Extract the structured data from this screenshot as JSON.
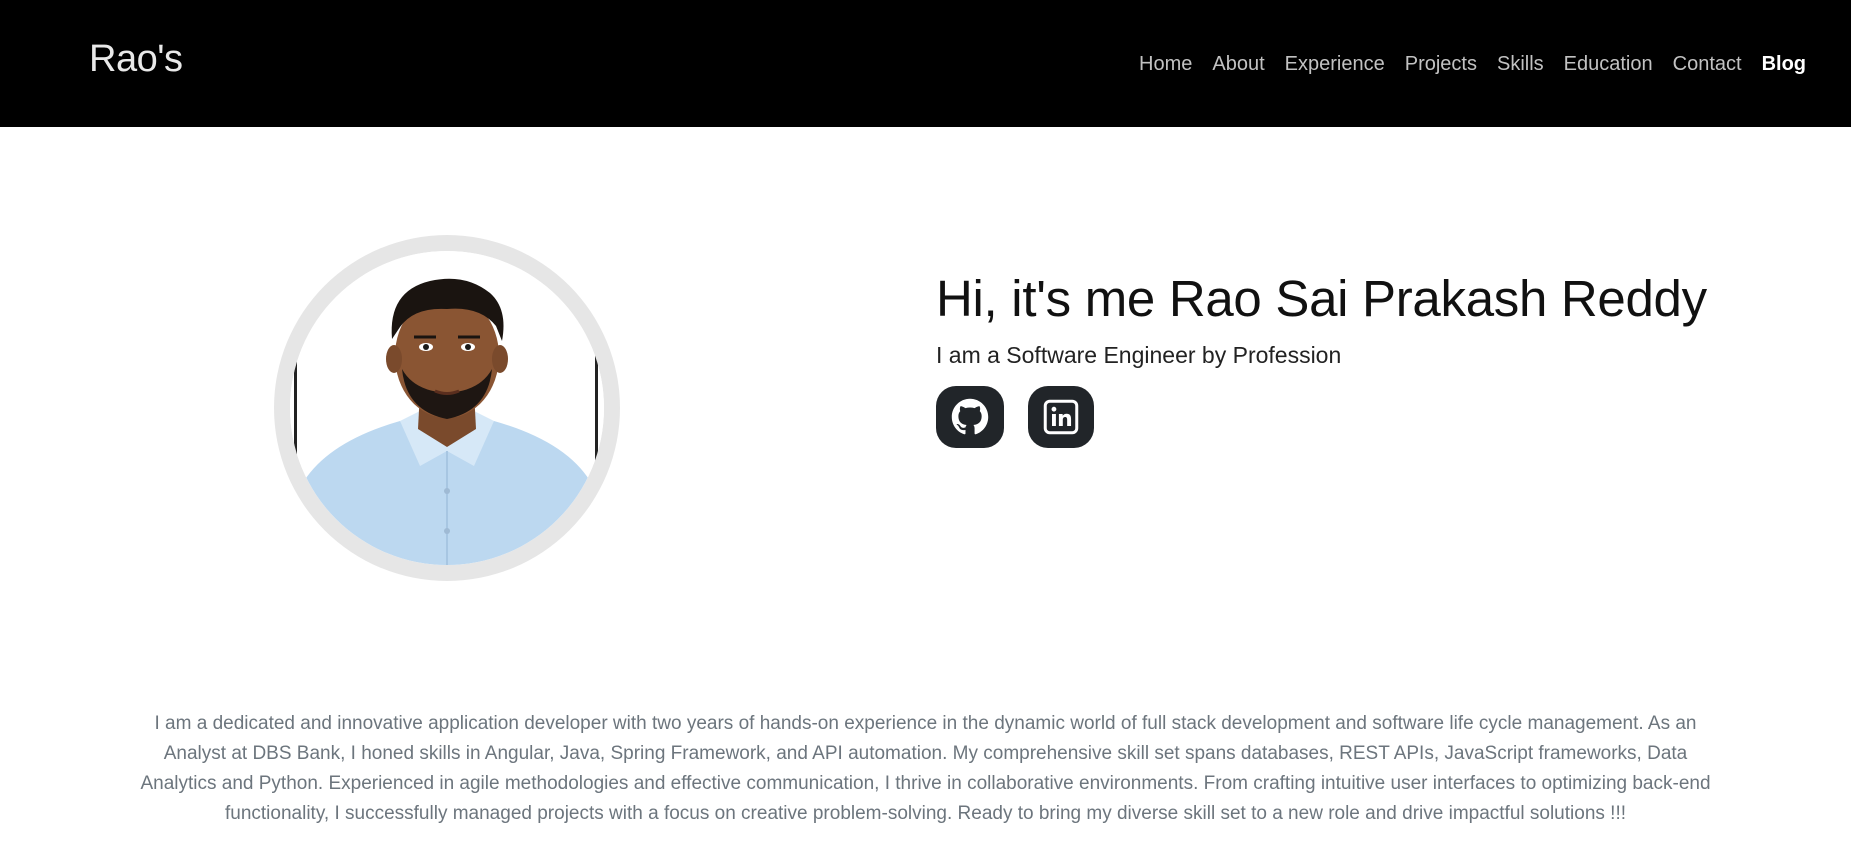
{
  "navbar": {
    "brand": "Rao's",
    "links": [
      "Home",
      "About",
      "Experience",
      "Projects",
      "Skills",
      "Education",
      "Contact",
      "Blog"
    ],
    "active_link": "Blog"
  },
  "hero": {
    "title": "Hi, it's me Rao Sai Prakash Reddy",
    "subtitle": "I am a Software Engineer by Profession",
    "socials": [
      {
        "icon": "github-icon",
        "label": "GitHub"
      },
      {
        "icon": "linkedin-icon",
        "label": "LinkedIn"
      }
    ]
  },
  "about": {
    "text": "I am a dedicated and innovative application developer with two years of hands-on experience in the dynamic world of full stack development and software life cycle management. As an Analyst at DBS Bank, I honed skills in Angular, Java, Spring Framework, and API automation. My comprehensive skill set spans databases, REST APIs, JavaScript frameworks, Data Analytics and Python. Experienced in agile methodologies and effective communication, I thrive in collaborative environments. From crafting intuitive user interfaces to optimizing back-end functionality, I successfully managed projects with a focus on creative problem-solving. Ready to bring my diverse skill set to a new role and drive impactful solutions !!!"
  },
  "colors": {
    "navbar_bg": "#000000",
    "nav_link": "#c2c2c2",
    "social_bg": "#212529",
    "muted_text": "#6c757d"
  }
}
